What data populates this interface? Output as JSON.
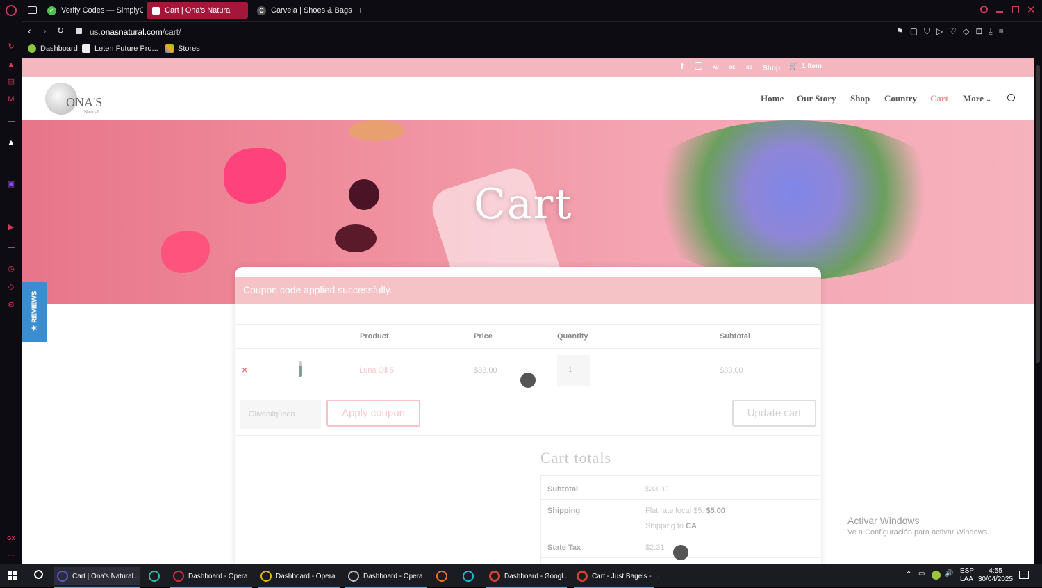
{
  "browser": {
    "tabs": [
      {
        "label": "Verify Codes — SimplyCo",
        "active": false
      },
      {
        "label": "Cart | Ona's Natural",
        "active": true
      },
      {
        "label": "Carvela | Shoes & Bags",
        "active": false
      }
    ],
    "url_prefix": "us.",
    "url_domain": "onasnatural.com",
    "url_path": "/cart/",
    "bookmarks": [
      "Dashboard",
      "Leten Future Pro...",
      "Stores"
    ]
  },
  "site": {
    "topstrip": {
      "au": "AU",
      "de": "DE",
      "gb": "GB",
      "shop": "Shop",
      "cart_count": "1 Item"
    },
    "logo_text": "ONA'S",
    "logo_sub": "Natural",
    "nav": [
      "Home",
      "Our Story",
      "Shop",
      "Country",
      "Cart",
      "More"
    ],
    "hero_title": "Cart",
    "reviews_tab": "★ REVIEWS"
  },
  "cart": {
    "notice": "Coupon code applied successfully.",
    "headers": {
      "product": "Product",
      "price": "Price",
      "quantity": "Quantity",
      "subtotal": "Subtotal"
    },
    "items": [
      {
        "remove": "×",
        "name": "Luna Oil 5",
        "price": "$33.00",
        "quantity": "1",
        "subtotal": "$33.00"
      }
    ],
    "coupon_value": "Oliveoilqueen",
    "apply_coupon": "Apply coupon",
    "update_cart": "Update cart",
    "totals_title": "Cart totals",
    "totals": {
      "subtotal_label": "Subtotal",
      "subtotal_value": "$33.00",
      "shipping_label": "Shipping",
      "shipping_method": "Flat rate local $5: ",
      "shipping_amount": "$5.00",
      "shipping_to_prefix": "Shipping to ",
      "shipping_to_region": "CA",
      "tax_label": "State Tax",
      "tax_value": "$2.31"
    }
  },
  "windows": {
    "activate_title": "Activar Windows",
    "activate_sub": "Ve a Configuración para activar Windows."
  },
  "taskbar": {
    "items": [
      {
        "label": "Cart | Ona's Natural..."
      },
      {
        "label": "Dashboard - Opera"
      },
      {
        "label": "Dashboard - Opera"
      },
      {
        "label": "Dashboard - Opera"
      },
      {
        "label": "Dashboard - Googl..."
      },
      {
        "label": "Cart - Just Bagels - ..."
      }
    ],
    "lang1": "ESP",
    "lang2": "LAA",
    "time": "4:55",
    "date": "30/04/2025"
  },
  "colors": {
    "accent": "#f08a96",
    "opera_red": "#d23a5a",
    "strip": "#f4b7bf"
  }
}
